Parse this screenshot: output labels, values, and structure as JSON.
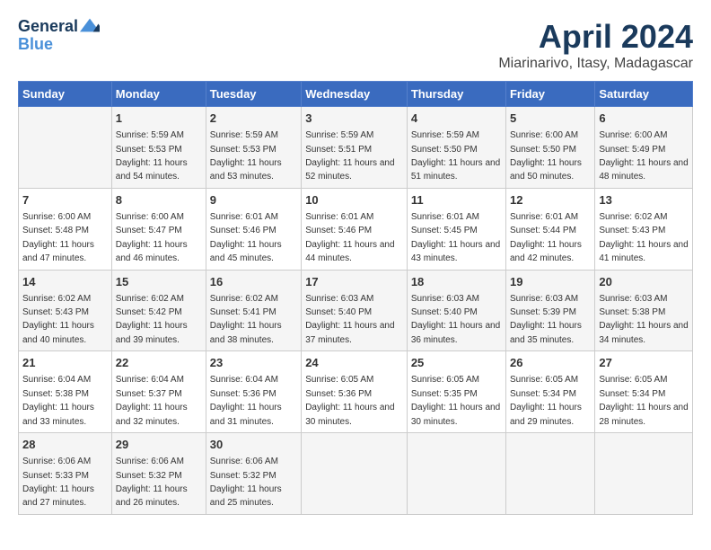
{
  "header": {
    "logo_line1": "General",
    "logo_line2": "Blue",
    "title": "April 2024",
    "subtitle": "Miarinarivo, Itasy, Madagascar"
  },
  "days_of_week": [
    "Sunday",
    "Monday",
    "Tuesday",
    "Wednesday",
    "Thursday",
    "Friday",
    "Saturday"
  ],
  "weeks": [
    [
      {
        "day": "",
        "sunrise": "",
        "sunset": "",
        "daylight": ""
      },
      {
        "day": "1",
        "sunrise": "Sunrise: 5:59 AM",
        "sunset": "Sunset: 5:53 PM",
        "daylight": "Daylight: 11 hours and 54 minutes."
      },
      {
        "day": "2",
        "sunrise": "Sunrise: 5:59 AM",
        "sunset": "Sunset: 5:53 PM",
        "daylight": "Daylight: 11 hours and 53 minutes."
      },
      {
        "day": "3",
        "sunrise": "Sunrise: 5:59 AM",
        "sunset": "Sunset: 5:51 PM",
        "daylight": "Daylight: 11 hours and 52 minutes."
      },
      {
        "day": "4",
        "sunrise": "Sunrise: 5:59 AM",
        "sunset": "Sunset: 5:50 PM",
        "daylight": "Daylight: 11 hours and 51 minutes."
      },
      {
        "day": "5",
        "sunrise": "Sunrise: 6:00 AM",
        "sunset": "Sunset: 5:50 PM",
        "daylight": "Daylight: 11 hours and 50 minutes."
      },
      {
        "day": "6",
        "sunrise": "Sunrise: 6:00 AM",
        "sunset": "Sunset: 5:49 PM",
        "daylight": "Daylight: 11 hours and 48 minutes."
      }
    ],
    [
      {
        "day": "7",
        "sunrise": "Sunrise: 6:00 AM",
        "sunset": "Sunset: 5:48 PM",
        "daylight": "Daylight: 11 hours and 47 minutes."
      },
      {
        "day": "8",
        "sunrise": "Sunrise: 6:00 AM",
        "sunset": "Sunset: 5:47 PM",
        "daylight": "Daylight: 11 hours and 46 minutes."
      },
      {
        "day": "9",
        "sunrise": "Sunrise: 6:01 AM",
        "sunset": "Sunset: 5:46 PM",
        "daylight": "Daylight: 11 hours and 45 minutes."
      },
      {
        "day": "10",
        "sunrise": "Sunrise: 6:01 AM",
        "sunset": "Sunset: 5:46 PM",
        "daylight": "Daylight: 11 hours and 44 minutes."
      },
      {
        "day": "11",
        "sunrise": "Sunrise: 6:01 AM",
        "sunset": "Sunset: 5:45 PM",
        "daylight": "Daylight: 11 hours and 43 minutes."
      },
      {
        "day": "12",
        "sunrise": "Sunrise: 6:01 AM",
        "sunset": "Sunset: 5:44 PM",
        "daylight": "Daylight: 11 hours and 42 minutes."
      },
      {
        "day": "13",
        "sunrise": "Sunrise: 6:02 AM",
        "sunset": "Sunset: 5:43 PM",
        "daylight": "Daylight: 11 hours and 41 minutes."
      }
    ],
    [
      {
        "day": "14",
        "sunrise": "Sunrise: 6:02 AM",
        "sunset": "Sunset: 5:43 PM",
        "daylight": "Daylight: 11 hours and 40 minutes."
      },
      {
        "day": "15",
        "sunrise": "Sunrise: 6:02 AM",
        "sunset": "Sunset: 5:42 PM",
        "daylight": "Daylight: 11 hours and 39 minutes."
      },
      {
        "day": "16",
        "sunrise": "Sunrise: 6:02 AM",
        "sunset": "Sunset: 5:41 PM",
        "daylight": "Daylight: 11 hours and 38 minutes."
      },
      {
        "day": "17",
        "sunrise": "Sunrise: 6:03 AM",
        "sunset": "Sunset: 5:40 PM",
        "daylight": "Daylight: 11 hours and 37 minutes."
      },
      {
        "day": "18",
        "sunrise": "Sunrise: 6:03 AM",
        "sunset": "Sunset: 5:40 PM",
        "daylight": "Daylight: 11 hours and 36 minutes."
      },
      {
        "day": "19",
        "sunrise": "Sunrise: 6:03 AM",
        "sunset": "Sunset: 5:39 PM",
        "daylight": "Daylight: 11 hours and 35 minutes."
      },
      {
        "day": "20",
        "sunrise": "Sunrise: 6:03 AM",
        "sunset": "Sunset: 5:38 PM",
        "daylight": "Daylight: 11 hours and 34 minutes."
      }
    ],
    [
      {
        "day": "21",
        "sunrise": "Sunrise: 6:04 AM",
        "sunset": "Sunset: 5:38 PM",
        "daylight": "Daylight: 11 hours and 33 minutes."
      },
      {
        "day": "22",
        "sunrise": "Sunrise: 6:04 AM",
        "sunset": "Sunset: 5:37 PM",
        "daylight": "Daylight: 11 hours and 32 minutes."
      },
      {
        "day": "23",
        "sunrise": "Sunrise: 6:04 AM",
        "sunset": "Sunset: 5:36 PM",
        "daylight": "Daylight: 11 hours and 31 minutes."
      },
      {
        "day": "24",
        "sunrise": "Sunrise: 6:05 AM",
        "sunset": "Sunset: 5:36 PM",
        "daylight": "Daylight: 11 hours and 30 minutes."
      },
      {
        "day": "25",
        "sunrise": "Sunrise: 6:05 AM",
        "sunset": "Sunset: 5:35 PM",
        "daylight": "Daylight: 11 hours and 30 minutes."
      },
      {
        "day": "26",
        "sunrise": "Sunrise: 6:05 AM",
        "sunset": "Sunset: 5:34 PM",
        "daylight": "Daylight: 11 hours and 29 minutes."
      },
      {
        "day": "27",
        "sunrise": "Sunrise: 6:05 AM",
        "sunset": "Sunset: 5:34 PM",
        "daylight": "Daylight: 11 hours and 28 minutes."
      }
    ],
    [
      {
        "day": "28",
        "sunrise": "Sunrise: 6:06 AM",
        "sunset": "Sunset: 5:33 PM",
        "daylight": "Daylight: 11 hours and 27 minutes."
      },
      {
        "day": "29",
        "sunrise": "Sunrise: 6:06 AM",
        "sunset": "Sunset: 5:32 PM",
        "daylight": "Daylight: 11 hours and 26 minutes."
      },
      {
        "day": "30",
        "sunrise": "Sunrise: 6:06 AM",
        "sunset": "Sunset: 5:32 PM",
        "daylight": "Daylight: 11 hours and 25 minutes."
      },
      {
        "day": "",
        "sunrise": "",
        "sunset": "",
        "daylight": ""
      },
      {
        "day": "",
        "sunrise": "",
        "sunset": "",
        "daylight": ""
      },
      {
        "day": "",
        "sunrise": "",
        "sunset": "",
        "daylight": ""
      },
      {
        "day": "",
        "sunrise": "",
        "sunset": "",
        "daylight": ""
      }
    ]
  ]
}
